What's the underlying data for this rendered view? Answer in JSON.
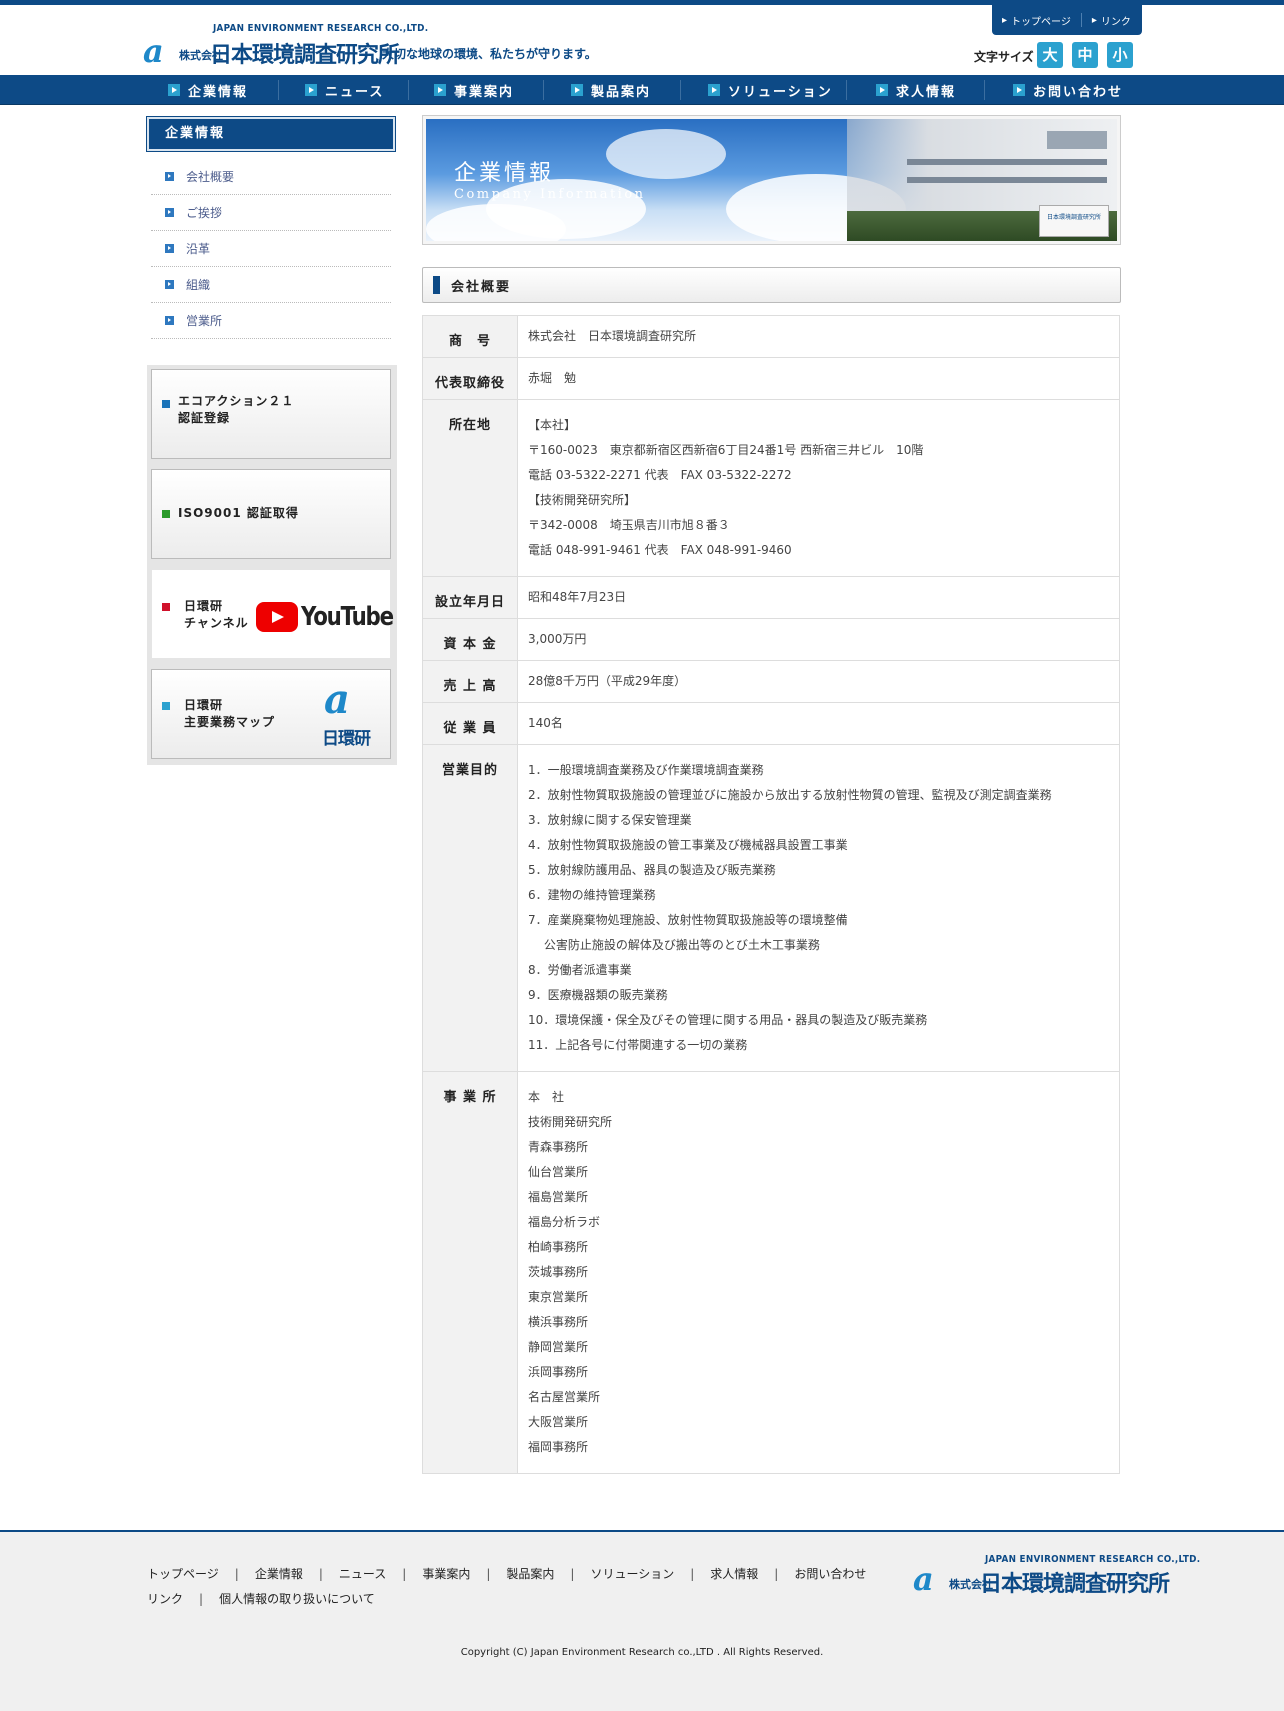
{
  "header": {
    "logo_en": "JAPAN ENVIRONMENT RESEARCH CO.,LTD.",
    "logo_kk": "株式会社",
    "logo_jp": "日本環境調査研究所",
    "tagline": "大切な地球の環境、私たちが守ります。",
    "util_links": [
      "トップページ",
      "リンク"
    ],
    "font_size_label": "文字サイズ",
    "font_sizes": [
      "大",
      "中",
      "小"
    ]
  },
  "nav": [
    "企業情報",
    "ニュース",
    "事業案内",
    "製品案内",
    "ソリューション",
    "求人情報",
    "お問い合わせ"
  ],
  "sidebar": {
    "title": "企業情報",
    "items": [
      "会社概要",
      "ご挨拶",
      "沿革",
      "組織",
      "営業所"
    ],
    "banners": [
      {
        "text": "エコアクション２１\n認証登録",
        "mark_color": "#1a73b8"
      },
      {
        "text": "ISO9001 認証取得",
        "mark_color": "#2a9a2a"
      },
      {
        "text": "日環研\nチャンネル",
        "mark_color": "#d0112b",
        "logo": "YouTube"
      },
      {
        "text": "日環研\n主要業務マップ",
        "mark_color": "#2ba1cf",
        "logo": "日環研"
      }
    ]
  },
  "hero": {
    "title_jp": "企業情報",
    "title_en": "Company Information"
  },
  "section_title": "会社概要",
  "table": [
    {
      "label": "商　号",
      "lines": [
        "株式会社　日本環境調査研究所"
      ]
    },
    {
      "label": "代表取締役",
      "lines": [
        "赤堀　勉"
      ]
    },
    {
      "label": "所在地",
      "lines": [
        "【本社】",
        "〒160-0023　東京都新宿区西新宿6丁目24番1号 西新宿三井ビル　10階",
        "電話 03-5322-2271 代表　FAX 03-5322-2272",
        "【技術開発研究所】",
        "〒342-0008　埼玉県吉川市旭８番３",
        "電話 048-991-9461 代表　FAX 048-991-9460"
      ]
    },
    {
      "label": "設立年月日",
      "lines": [
        "昭和48年7月23日"
      ]
    },
    {
      "label": "資 本 金",
      "lines": [
        "3,000万円"
      ]
    },
    {
      "label": "売 上 高",
      "lines": [
        "28億8千万円（平成29年度）"
      ]
    },
    {
      "label": "従 業 員",
      "lines": [
        "140名"
      ]
    },
    {
      "label": "営業目的",
      "lines": [
        "1．一般環境調査業務及び作業環境調査業務",
        "2．放射性物質取扱施設の管理並びに施設から放出する放射性物質の管理、監視及び測定調査業務",
        "3．放射線に関する保安管理業",
        "4．放射性物質取扱施設の管工事業及び機械器具設置工事業",
        "5．放射線防護用品、器具の製造及び販売業務",
        "6．建物の維持管理業務",
        "7．産業廃棄物処理施設、放射性物質取扱施設等の環境整備",
        "　 公害防止施設の解体及び搬出等のとび土木工事業務",
        "8．労働者派遣事業",
        "9．医療機器類の販売業務",
        "10．環境保護・保全及びその管理に関する用品・器具の製造及び販売業務",
        "11．上記各号に付帯関連する一切の業務"
      ]
    },
    {
      "label": "事 業 所",
      "lines": [
        "本　社",
        "技術開発研究所",
        "青森事務所",
        "仙台営業所",
        "福島営業所",
        "福島分析ラボ",
        "柏崎事務所",
        "茨城事務所",
        "東京営業所",
        "横浜事務所",
        "静岡営業所",
        "浜岡事務所",
        "名古屋営業所",
        "大阪営業所",
        "福岡事務所"
      ]
    }
  ],
  "footer": {
    "links": [
      "トップページ",
      "企業情報",
      "ニュース",
      "事業案内",
      "製品案内",
      "ソリューション",
      "求人情報",
      "お問い合わせ",
      "リンク",
      "個人情報の取り扱いについて"
    ],
    "separator": "|",
    "copyright": "Copyright (C) Japan Environment Research co.,LTD . All Rights Reserved."
  }
}
